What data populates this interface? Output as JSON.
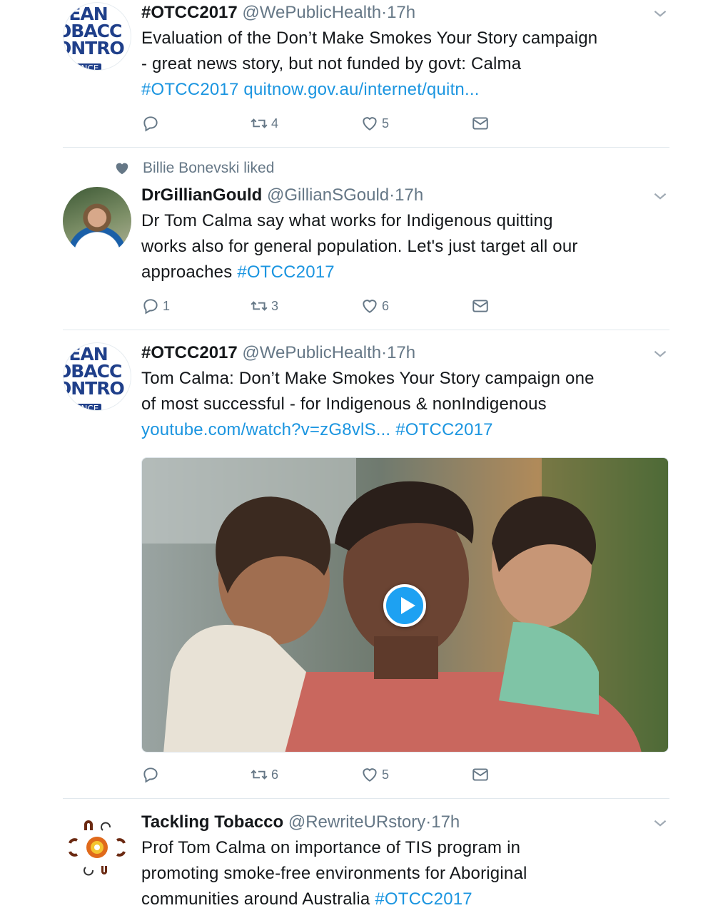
{
  "tweets": [
    {
      "name": "#OTCC2017",
      "handle": "@WePublicHealth",
      "time": "17h",
      "text_lines": [
        "Evaluation of the Don’t Make Smokes Your Story campaign",
        "- great news story, but not funded by govt: Calma"
      ],
      "links": [
        "#OTCC2017",
        "quitnow.gov.au/internet/quitn..."
      ],
      "replies": "",
      "retweets": "4",
      "likes": "5",
      "avatar_text": [
        "CEAN",
        "OBACC",
        "ONTRO",
        "FERENCE"
      ]
    },
    {
      "social_context": "Billie Bonevski liked",
      "name": "DrGillianGould",
      "handle": "@GillianSGould",
      "time": "17h",
      "text_lines": [
        "Dr Tom Calma say what works for Indigenous quitting",
        "works also for general population. Let's just target all our",
        "approaches"
      ],
      "hashtag": "#OTCC2017",
      "replies": "1",
      "retweets": "3",
      "likes": "6"
    },
    {
      "name": "#OTCC2017",
      "handle": "@WePublicHealth",
      "time": "17h",
      "text_lines": [
        "Tom Calma: Don’t Make Smokes Your Story campaign one",
        "of most successful - for Indigenous & nonIndigenous"
      ],
      "link": "youtube.com/watch?v=zG8vlS...",
      "hashtag": "#OTCC2017",
      "replies": "",
      "retweets": "6",
      "likes": "5",
      "avatar_text": [
        "CEAN",
        "OBACC",
        "ONTRO",
        "FERENCE"
      ]
    },
    {
      "name": "Tackling Tobacco",
      "handle": "@RewriteURstory",
      "time": "17h",
      "text_lines": [
        "Prof Tom Calma on importance of TIS program in",
        "promoting smoke-free environments for Aboriginal",
        "communities around Australia"
      ],
      "hashtag": "#OTCC2017"
    }
  ],
  "separator": "·",
  "colors": {
    "link": "#1b95e0",
    "muted": "#657786",
    "text": "#14171a",
    "divider": "#e1e8ed"
  }
}
